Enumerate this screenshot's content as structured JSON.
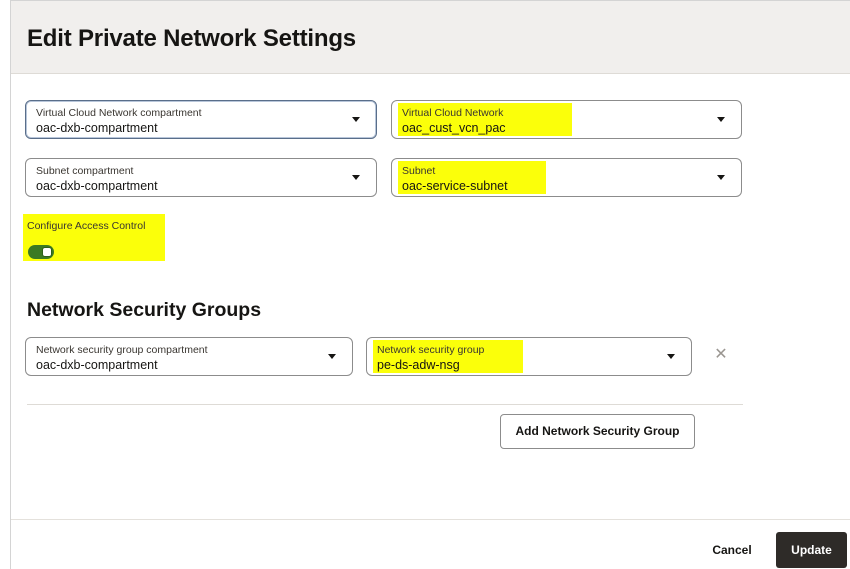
{
  "dialog": {
    "title": "Edit Private Network Settings"
  },
  "vcn_compartment": {
    "label": "Virtual Cloud Network compartment",
    "value": "oac-dxb-compartment"
  },
  "vcn": {
    "label": "Virtual Cloud Network",
    "value": "oac_cust_vcn_pac"
  },
  "subnet_compartment": {
    "label": "Subnet compartment",
    "value": "oac-dxb-compartment"
  },
  "subnet": {
    "label": "Subnet",
    "value": "oac-service-subnet"
  },
  "access_control": {
    "label": "Configure Access Control",
    "enabled": true
  },
  "nsg_section": {
    "title": "Network Security Groups",
    "compartment": {
      "label": "Network security group compartment",
      "value": "oac-dxb-compartment"
    },
    "group": {
      "label": "Network security group",
      "value": "pe-ds-adw-nsg"
    },
    "add_label": "Add Network Security Group"
  },
  "footer": {
    "cancel_label": "Cancel",
    "update_label": "Update"
  },
  "colors": {
    "highlight": "#fbff0a",
    "toggle_on": "#3b7a23",
    "primary_button": "#2e2b28",
    "header_bg": "#f1efed"
  },
  "icons": {
    "dropdown": "chevron-down-icon",
    "remove": "close-icon"
  }
}
